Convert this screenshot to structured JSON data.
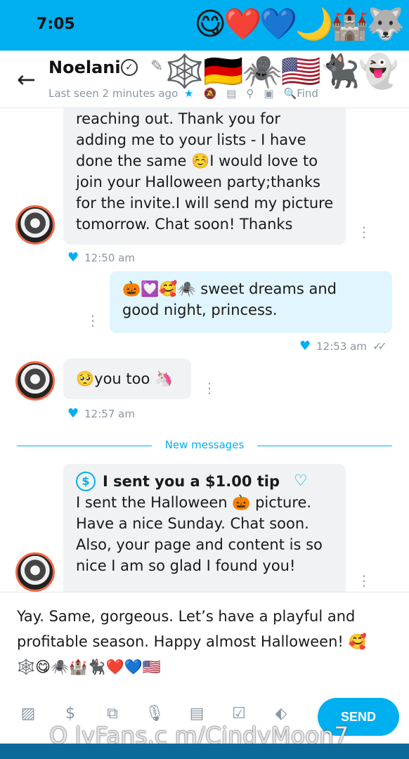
{
  "status_bar": {
    "time": "7:05",
    "emojis": "😋❤️💙🌙🏰🐺"
  },
  "header": {
    "name": "Noelani",
    "last_seen": "Last seen 2 minutes ago",
    "emojis": "🕸️🇩🇪🕷️🇺🇸🐈‍⬛👻",
    "find_label": "Find"
  },
  "messages": {
    "m1": {
      "lines": [
        "reaching out. Thank you for",
        "adding me to your lists - I have",
        "done the same ☺️I would love to",
        "join your Halloween party;thanks",
        "for the invite.I will send my picture",
        "tomorrow. Chat soon! Thanks"
      ],
      "time": "12:50 am"
    },
    "m2": {
      "lines": [
        "🎃💟🥰🕷️ sweet dreams and",
        "good night, princess."
      ],
      "time": "12:53 am"
    },
    "m3": {
      "text": "🥺you too 🦄",
      "time": "12:57 am"
    },
    "divider": "New messages",
    "m4": {
      "tip_title": "I sent you a $1.00 tip",
      "lines": [
        "I sent the Halloween 🎃 picture.",
        "Have a nice Sunday. Chat soon.",
        "Also, your page and content is so",
        "nice I am so glad I found you!"
      ]
    }
  },
  "composer": {
    "lines": [
      "Yay. Same, gorgeous. Let’s have a playful and",
      "profitable season. Happy almost Halloween! 🥰",
      "🕸️😋🕷️🏰🐈‍⬛❤️💙🇺🇸"
    ],
    "send_label": "SEND"
  },
  "watermark": "O lyFans.c m/CindyMoon7",
  "colors": {
    "accent": "#00aff0",
    "avatar_ring": "#f06a4a"
  }
}
